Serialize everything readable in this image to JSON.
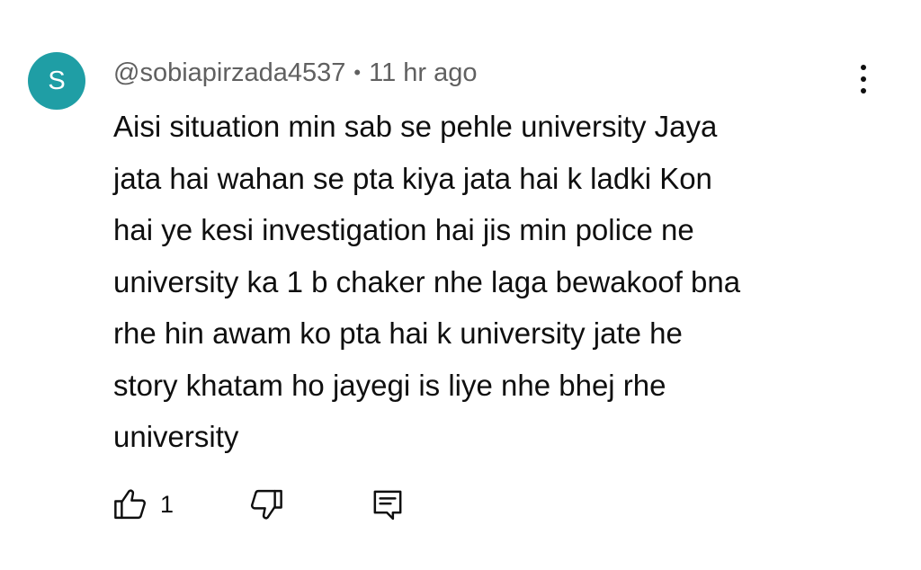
{
  "comment": {
    "avatar_letter": "S",
    "avatar_color": "#1f9ea5",
    "handle": "@sobiapirzada4537",
    "separator": "•",
    "time": "11 hr ago",
    "text_lines": [
      "Aisi situation min sab se pehle university Jaya",
      "jata hai wahan se pta kiya jata hai k ladki Kon",
      "hai ye kesi investigation hai jis min police ne",
      "university ka 1 b chaker nhe laga bewakoof bna",
      "rhe hin awam ko pta hai k university jate he",
      "story khatam ho jayegi is liye nhe bhej rhe",
      "university"
    ],
    "like_count": "1",
    "icons": {
      "more": "more-vert-icon",
      "like": "thumbs-up-icon",
      "dislike": "thumbs-down-icon",
      "reply": "reply-comment-icon"
    }
  }
}
